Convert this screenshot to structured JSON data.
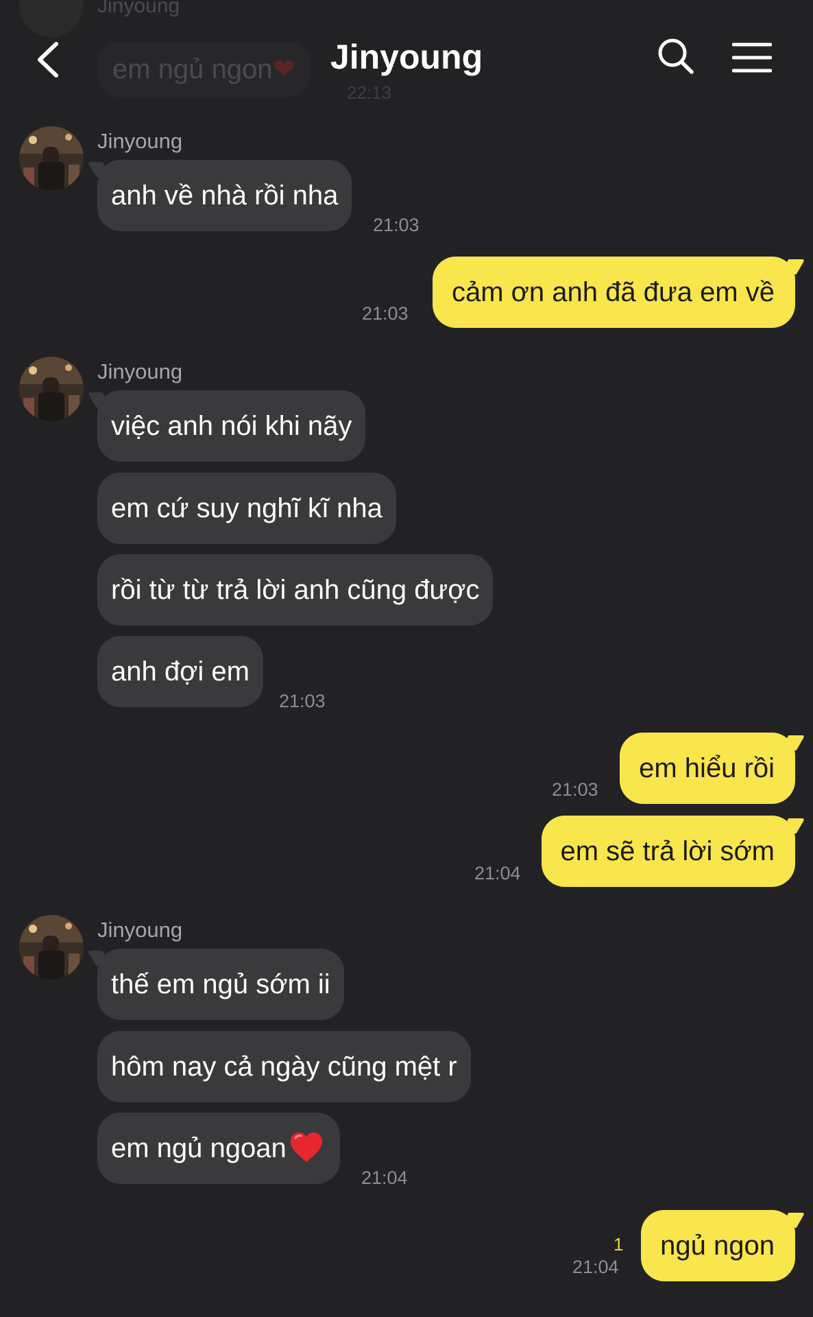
{
  "header": {
    "title": "Jinyoung",
    "back_icon": "chevron-left-icon",
    "search_icon": "search-icon",
    "menu_icon": "hamburger-menu-icon",
    "ghost_sender": "Jinyoung",
    "ghost_message": "em ngủ ngon",
    "ghost_time": "22:13"
  },
  "colors": {
    "background": "#222225",
    "incoming_bubble": "#3a3a3d",
    "outgoing_bubble": "#f9e54c",
    "unread_count": "#f0d63a"
  },
  "messages": [
    {
      "id": "m1",
      "dir": "in",
      "sender": "Jinyoung",
      "text": "anh về nhà rồi nha",
      "time": "21:03"
    },
    {
      "id": "m2",
      "dir": "out",
      "text": "cảm ơn anh đã đưa em về",
      "time": "21:03"
    },
    {
      "id": "m3",
      "dir": "in",
      "sender": "Jinyoung",
      "text": "việc anh nói khi nãy"
    },
    {
      "id": "m4",
      "dir": "in",
      "text": "em cứ suy nghĩ kĩ nha"
    },
    {
      "id": "m5",
      "dir": "in",
      "text": "rồi từ từ trả lời anh cũng được"
    },
    {
      "id": "m6",
      "dir": "in",
      "text": "anh đợi em",
      "time": "21:03"
    },
    {
      "id": "m7",
      "dir": "out",
      "text": "em hiểu rồi",
      "time": "21:03"
    },
    {
      "id": "m8",
      "dir": "out",
      "text": "em sẽ trả lời sớm",
      "time": "21:04"
    },
    {
      "id": "m9",
      "dir": "in",
      "sender": "Jinyoung",
      "text": "thế em ngủ sớm ii"
    },
    {
      "id": "m10",
      "dir": "in",
      "text": "hôm nay cả ngày cũng mệt r"
    },
    {
      "id": "m11",
      "dir": "in",
      "text": "em ngủ ngoan",
      "emoji": "red-heart-icon",
      "time": "21:04"
    },
    {
      "id": "m12",
      "dir": "out",
      "text": "ngủ ngon",
      "time": "21:04",
      "unread": "1"
    }
  ]
}
